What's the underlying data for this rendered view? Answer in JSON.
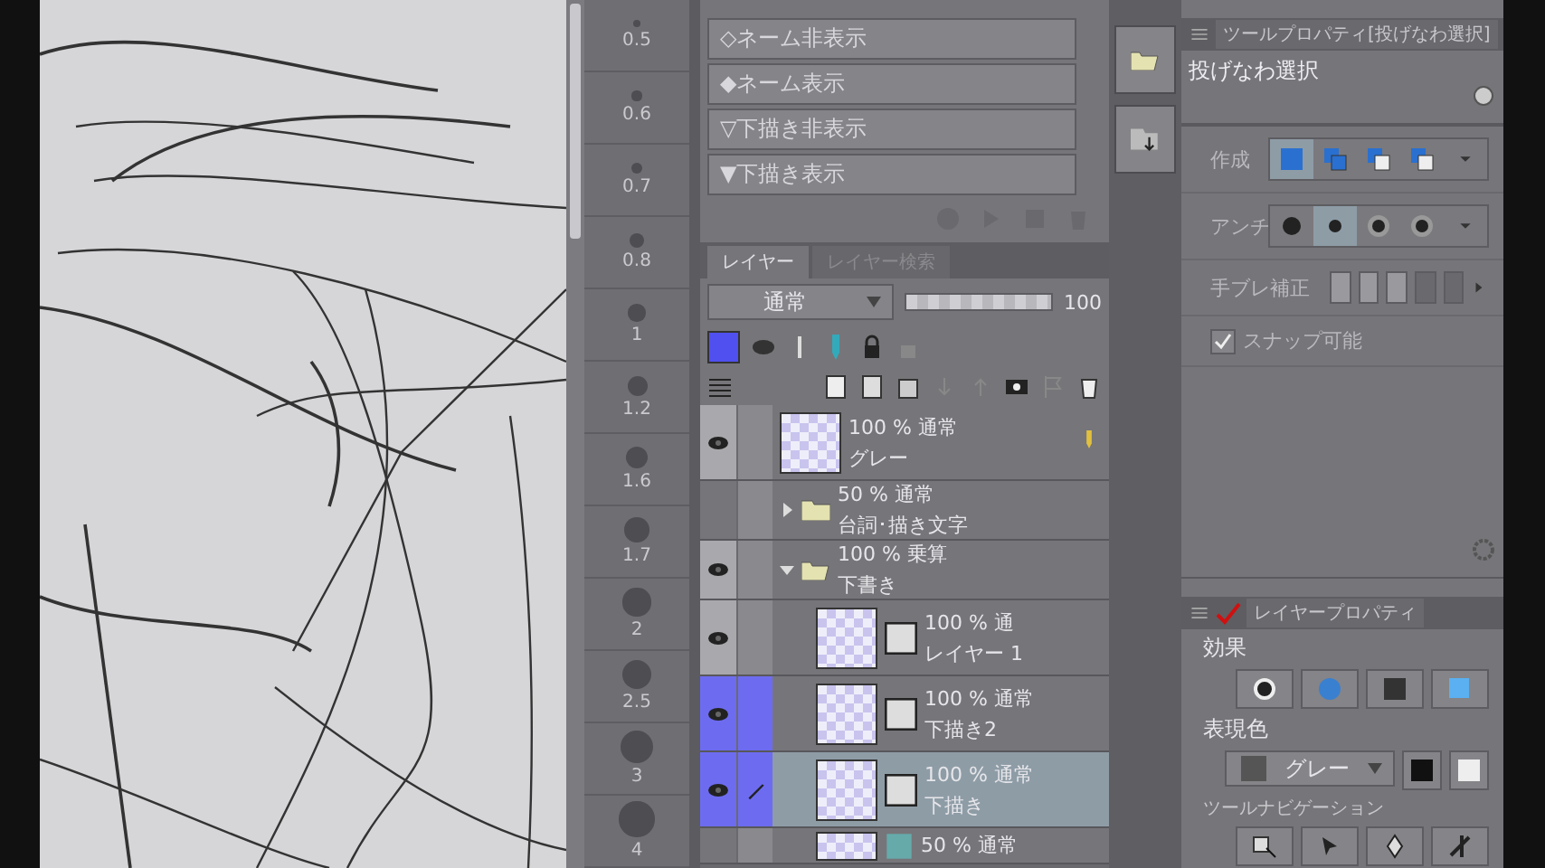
{
  "brush_sizes": [
    {
      "size": "0.5"
    },
    {
      "size": "0.6"
    },
    {
      "size": "0.7"
    },
    {
      "size": "0.8"
    },
    {
      "size": "1"
    },
    {
      "size": "1.2"
    },
    {
      "size": "1.6"
    },
    {
      "size": "1.7"
    },
    {
      "size": "2"
    },
    {
      "size": "2.5"
    },
    {
      "size": "3"
    },
    {
      "size": "4"
    }
  ],
  "auto_actions": {
    "items": [
      {
        "label": "◇ネーム非表示"
      },
      {
        "label": "◆ネーム表示"
      },
      {
        "label": "▽下描き非表示"
      },
      {
        "label": "▼下描き表示"
      }
    ]
  },
  "layer_panel": {
    "tabs": [
      {
        "label": "レイヤー",
        "selected": true
      },
      {
        "label": "レイヤー検索",
        "selected": false
      }
    ],
    "blend_mode": "通常",
    "opacity": "100",
    "opacity_slider": {
      "level": 1
    },
    "layers": [
      {
        "kind": "raster",
        "opacity": "100 %",
        "blend": "通常",
        "name": "グレー",
        "visible": true,
        "marked": false,
        "selected": false
      },
      {
        "kind": "folder",
        "opacity": "50 %",
        "blend": "通常",
        "name": "台詞･描き文字",
        "visible": false,
        "expanded": false,
        "marked": false,
        "selected": false
      },
      {
        "kind": "folder",
        "opacity": "100 %",
        "blend": "乗算",
        "name": "下書き",
        "visible": true,
        "expanded": true,
        "marked": false,
        "selected": false,
        "children": [
          {
            "kind": "masked",
            "opacity": "100 % 通",
            "name": "レイヤー 1",
            "visible": true,
            "marked": false,
            "selected": false
          },
          {
            "kind": "masked",
            "opacity": "100 %",
            "blend": "通常",
            "name": "下描き2",
            "visible": true,
            "marked": true,
            "selected": false
          },
          {
            "kind": "masked",
            "opacity": "100 %",
            "blend": "通常",
            "name": "下描き",
            "visible": true,
            "marked": true,
            "selected": true
          },
          {
            "kind": "color",
            "opacity": "50 %",
            "blend": "通常",
            "visible": false,
            "marked": false,
            "selected": false
          }
        ]
      }
    ]
  },
  "tool_property": {
    "tab": "ツールプロパティ[投げなわ選択]",
    "title": "投げなわ選択",
    "rows": [
      {
        "kind": "modes",
        "label": "作成"
      },
      {
        "kind": "antialias",
        "label": "アンチ"
      },
      {
        "kind": "segments",
        "label": "手ブレ補正"
      },
      {
        "kind": "check",
        "label": "スナップ可能",
        "checked": true
      }
    ]
  },
  "layer_property": {
    "tab": "レイヤープロパティ",
    "effect_label": "効果",
    "color_label": "表現色",
    "color_mode": "グレー",
    "navigation_label": "ツールナビゲーション"
  }
}
